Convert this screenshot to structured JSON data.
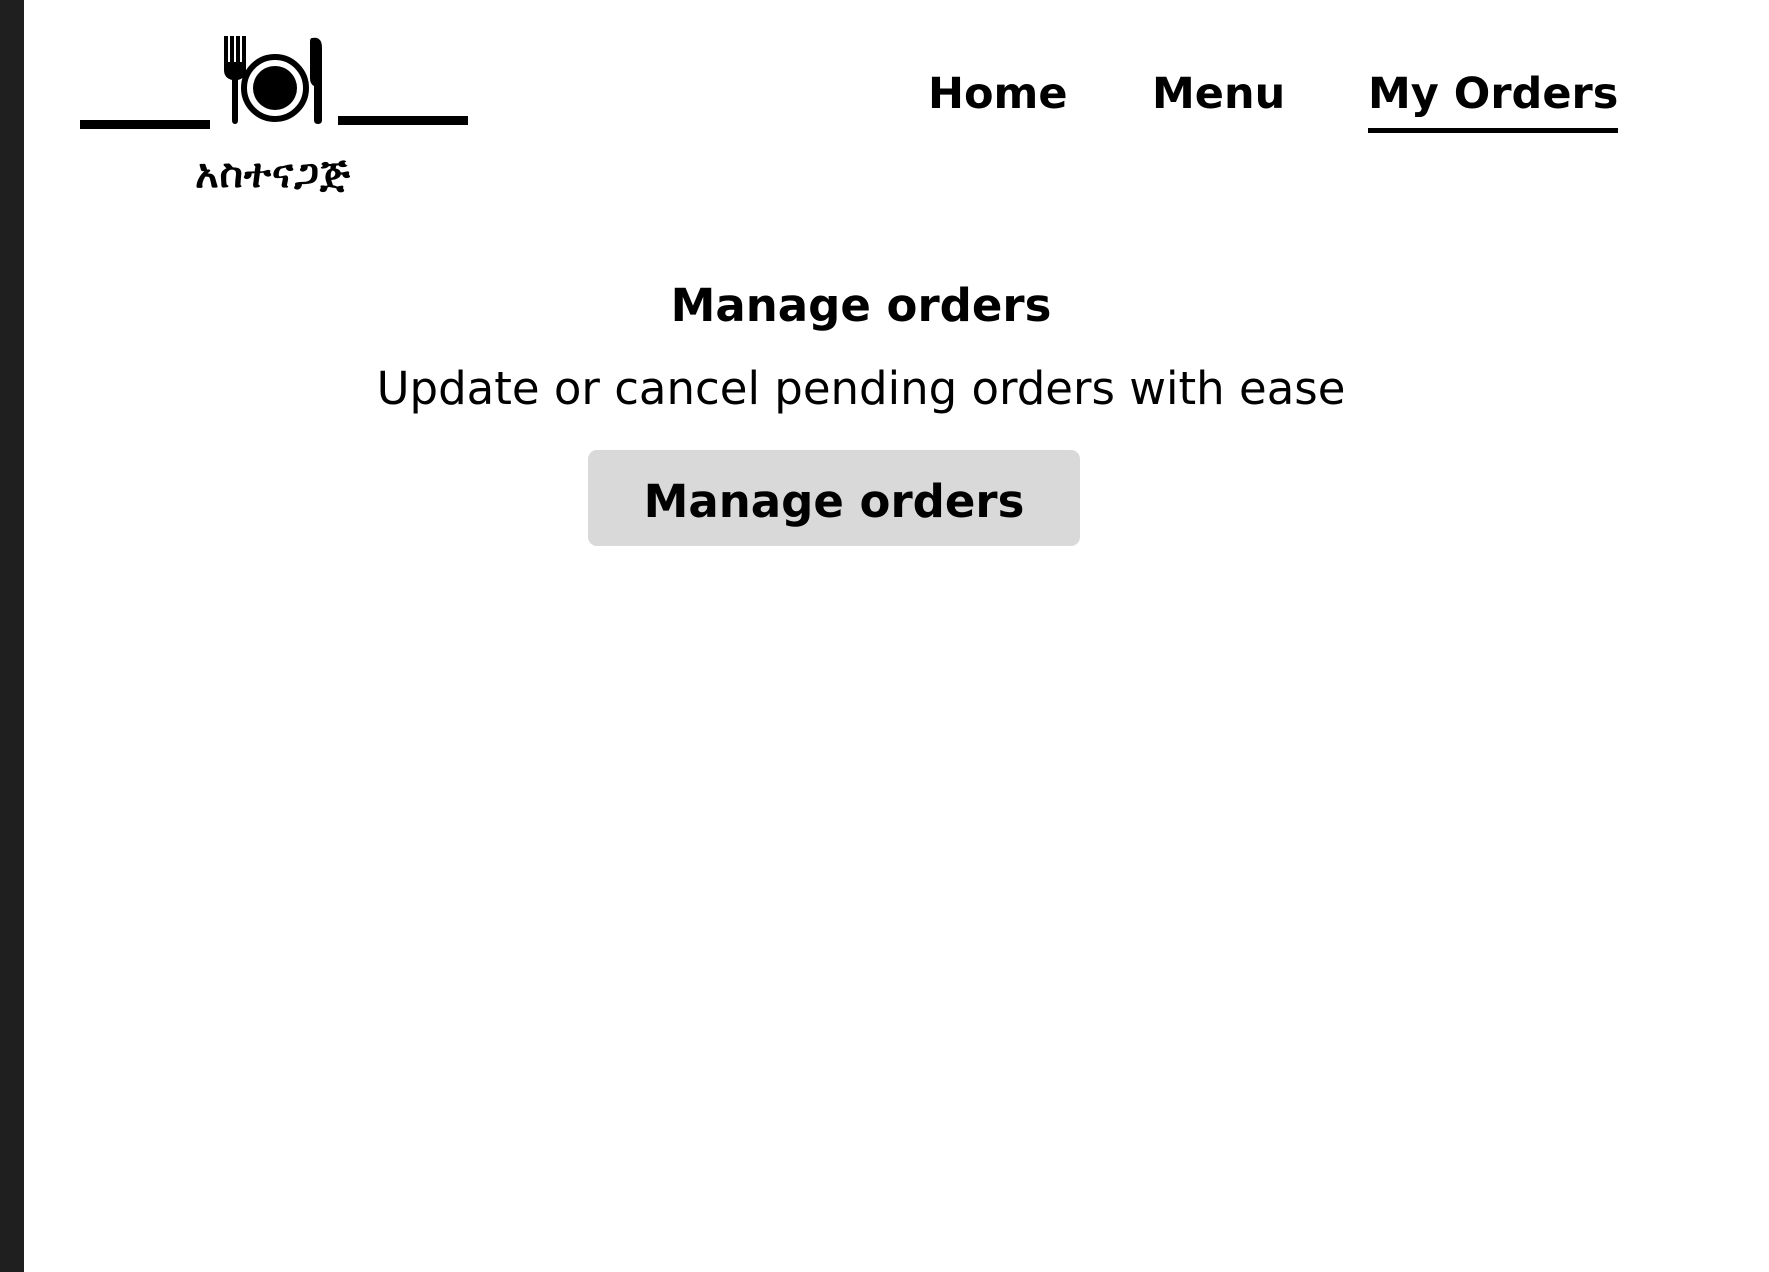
{
  "logo": {
    "icon": "fork-plate-knife-icon",
    "text": "አስተናጋጅ"
  },
  "nav": {
    "items": [
      {
        "label": "Home",
        "active": false
      },
      {
        "label": "Menu",
        "active": false
      },
      {
        "label": "My Orders",
        "active": true
      }
    ]
  },
  "main": {
    "title": "Manage orders",
    "subtitle": "Update or cancel pending orders with ease",
    "button_label": "Manage orders"
  },
  "colors": {
    "text": "#000000",
    "background": "#ffffff",
    "button_bg": "#d9d9d9",
    "left_edge": "#1f1f1f"
  }
}
